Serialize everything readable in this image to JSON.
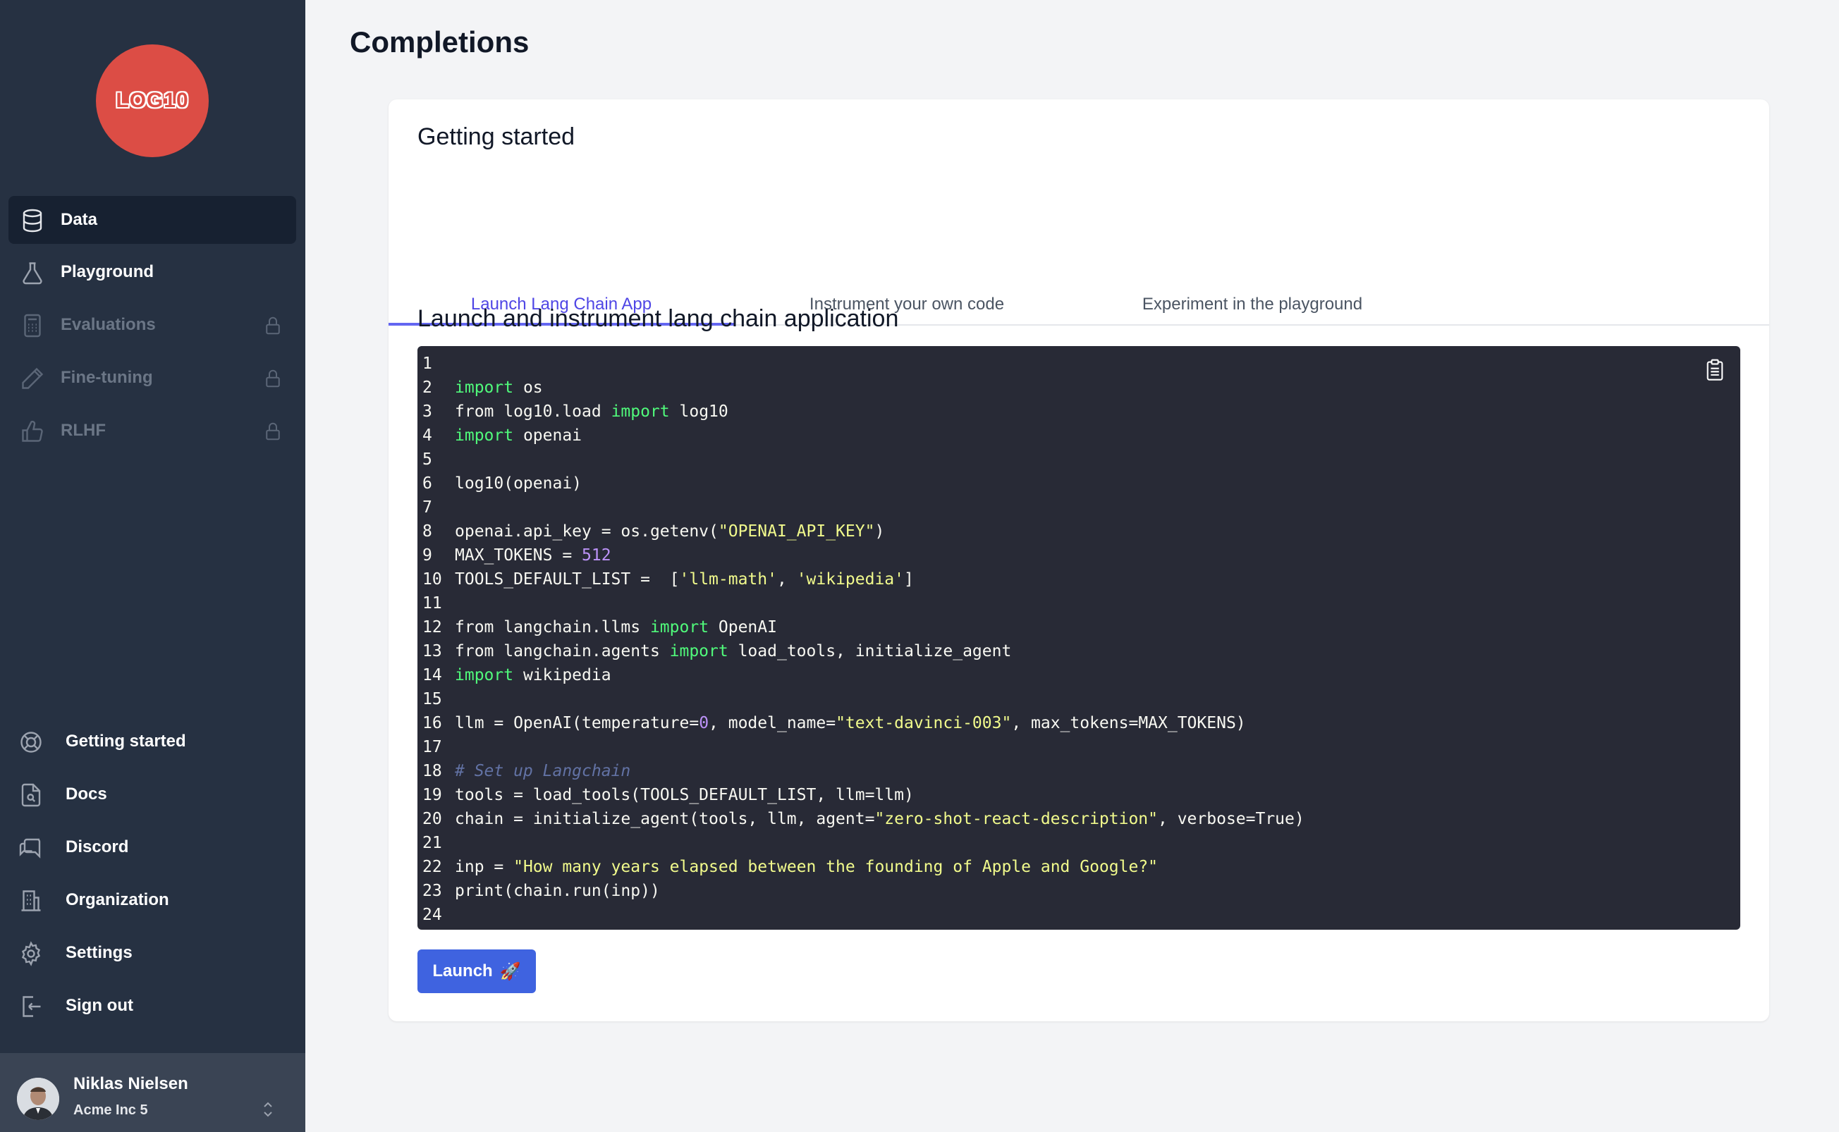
{
  "app": {
    "logo_text": "LOG10",
    "page_title": "Completions"
  },
  "sidebar": {
    "top_items": [
      {
        "label": "Data",
        "icon": "database-icon",
        "active": true,
        "locked": false
      },
      {
        "label": "Playground",
        "icon": "flask-icon",
        "active": false,
        "locked": false
      },
      {
        "label": "Evaluations",
        "icon": "calculator-icon",
        "active": false,
        "locked": true
      },
      {
        "label": "Fine-tuning",
        "icon": "pencil-icon",
        "active": false,
        "locked": true
      },
      {
        "label": "RLHF",
        "icon": "thumbs-up-icon",
        "active": false,
        "locked": true
      }
    ],
    "bottom_items": [
      {
        "label": "Getting started",
        "icon": "lifebuoy-icon"
      },
      {
        "label": "Docs",
        "icon": "document-search-icon"
      },
      {
        "label": "Discord",
        "icon": "chat-icon"
      },
      {
        "label": "Organization",
        "icon": "building-icon"
      },
      {
        "label": "Settings",
        "icon": "gear-icon"
      },
      {
        "label": "Sign out",
        "icon": "sign-out-icon"
      }
    ],
    "user": {
      "name": "Niklas Nielsen",
      "org": "Acme Inc 5"
    }
  },
  "card": {
    "title": "Getting started",
    "tabs": [
      {
        "label": "Launch Lang Chain App",
        "active": true
      },
      {
        "label": "Instrument your own code",
        "active": false
      },
      {
        "label": "Experiment in the playground",
        "active": false
      }
    ],
    "section_title": "Launch and instrument lang chain application",
    "code_lines": [
      "",
      "import os",
      "from log10.load import log10",
      "import openai",
      "",
      "log10(openai)",
      "",
      "openai.api_key = os.getenv(\"OPENAI_API_KEY\")",
      "MAX_TOKENS = 512",
      "TOOLS_DEFAULT_LIST =  ['llm-math', 'wikipedia']",
      "",
      "from langchain.llms import OpenAI",
      "from langchain.agents import load_tools, initialize_agent",
      "import wikipedia",
      "",
      "llm = OpenAI(temperature=0, model_name=\"text-davinci-003\", max_tokens=MAX_TOKENS)",
      "",
      "# Set up Langchain",
      "tools = load_tools(TOOLS_DEFAULT_LIST, llm=llm)",
      "chain = initialize_agent(tools, llm, agent=\"zero-shot-react-description\", verbose=True)",
      "",
      "inp = \"How many years elapsed between the founding of Apple and Google?\"",
      "print(chain.run(inp))",
      ""
    ],
    "launch_label": "Launch",
    "launch_emoji": "🚀"
  },
  "colors": {
    "sidebar_bg": "#263142",
    "accent": "#4f46e5",
    "launch_button": "#3f63e0",
    "code_bg": "#282a36",
    "logo_bg": "#dc4d45"
  }
}
